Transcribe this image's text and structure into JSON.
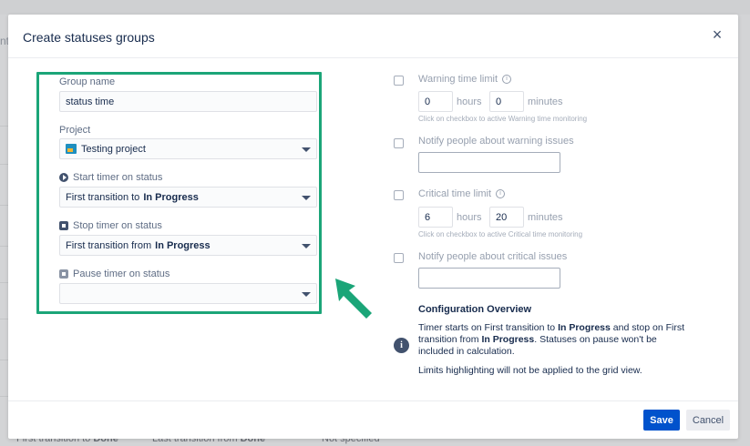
{
  "background": {
    "left_text": "nt",
    "bottom_cells": [
      {
        "prefix": "First transition to ",
        "status": "Done"
      },
      {
        "prefix": "Last transition from ",
        "status": "Done"
      },
      {
        "prefix": "Not specified",
        "status": ""
      }
    ]
  },
  "modal": {
    "title": "Create statuses groups",
    "close_icon": "×",
    "group_name": {
      "label": "Group name",
      "value": "status time"
    },
    "project": {
      "label": "Project",
      "value": "Testing project"
    },
    "start_timer": {
      "label": "Start timer on status",
      "prefix": "First transition to",
      "status": "In Progress"
    },
    "stop_timer": {
      "label": "Stop timer on status",
      "prefix": "First transition from",
      "status": "In Progress"
    },
    "pause_timer": {
      "label": "Pause timer on status",
      "value": ""
    },
    "warning": {
      "label": "Warning time limit",
      "info_icon": "i",
      "hours_value": "0",
      "hours_unit": "hours",
      "minutes_value": "0",
      "minutes_unit": "minutes",
      "hint": "Click on checkbox to active Warning time monitoring"
    },
    "notify_warning": {
      "label": "Notify people about warning issues",
      "value": ""
    },
    "critical": {
      "label": "Critical time limit",
      "info_icon": "i",
      "hours_value": "6",
      "hours_unit": "hours",
      "minutes_value": "20",
      "minutes_unit": "minutes",
      "hint": "Click on checkbox to active Critical time monitoring"
    },
    "notify_critical": {
      "label": "Notify people about critical issues",
      "value": ""
    },
    "overview": {
      "title": "Configuration Overview",
      "info_icon": "i",
      "text_1": "Timer starts on First transition to ",
      "status_1": "In Progress",
      "text_2": " and stop on First transition from ",
      "status_2": "In Progress",
      "text_3": ". Statuses on pause won't be included in calculation.",
      "note": "Limits highlighting will not be applied to the grid view."
    },
    "footer": {
      "save_label": "Save",
      "cancel_label": "Cancel"
    }
  },
  "colors": {
    "highlight_border": "#1ba578",
    "primary": "#0052cc",
    "arrow": "#1ba578"
  }
}
